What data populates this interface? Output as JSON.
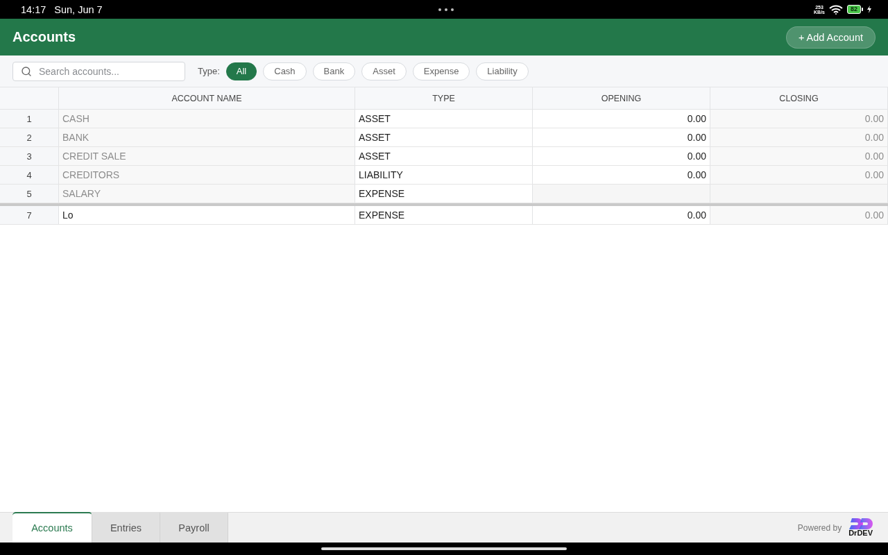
{
  "status_bar": {
    "time": "14:17",
    "date": "Sun, Jun 7",
    "network_speed": "253",
    "network_unit": "KB/s",
    "battery": "82",
    "charging": true
  },
  "header": {
    "title": "Accounts",
    "add_button": "+ Add Account"
  },
  "toolbar": {
    "search": {
      "placeholder": "Search accounts..."
    },
    "type_label": "Type:",
    "filters": [
      {
        "label": "All",
        "selected": true
      },
      {
        "label": "Cash",
        "selected": false
      },
      {
        "label": "Bank",
        "selected": false
      },
      {
        "label": "Asset",
        "selected": false
      },
      {
        "label": "Expense",
        "selected": false
      },
      {
        "label": "Liability",
        "selected": false
      }
    ]
  },
  "table": {
    "columns": [
      "ACCOUNT NAME",
      "TYPE",
      "OPENING",
      "CLOSING"
    ],
    "row_groups": [
      {
        "rows": [
          {
            "number": "1",
            "name": "CASH",
            "type": "ASSET",
            "opening": "0.00",
            "closing": "0.00",
            "locked": true
          },
          {
            "number": "2",
            "name": "BANK",
            "type": "ASSET",
            "opening": "0.00",
            "closing": "0.00",
            "locked": true
          },
          {
            "number": "3",
            "name": "CREDIT SALE",
            "type": "ASSET",
            "opening": "0.00",
            "closing": "0.00",
            "locked": true
          },
          {
            "number": "4",
            "name": "CREDITORS",
            "type": "LIABILITY",
            "opening": "0.00",
            "closing": "0.00",
            "locked": true
          },
          {
            "number": "5",
            "name": "SALARY",
            "type": "EXPENSE",
            "locked": true
          }
        ]
      },
      {
        "rows": [
          {
            "number": "7",
            "name": "Lo",
            "type": "EXPENSE",
            "opening": "0.00",
            "closing": "0.00",
            "locked": false
          }
        ]
      }
    ]
  },
  "bottom_tabs": [
    {
      "label": "Accounts",
      "selected": true
    },
    {
      "label": "Entries",
      "selected": false
    },
    {
      "label": "Payroll",
      "selected": false
    }
  ],
  "footer": {
    "powered_by": "Powered by",
    "brand": "DrDEV"
  }
}
